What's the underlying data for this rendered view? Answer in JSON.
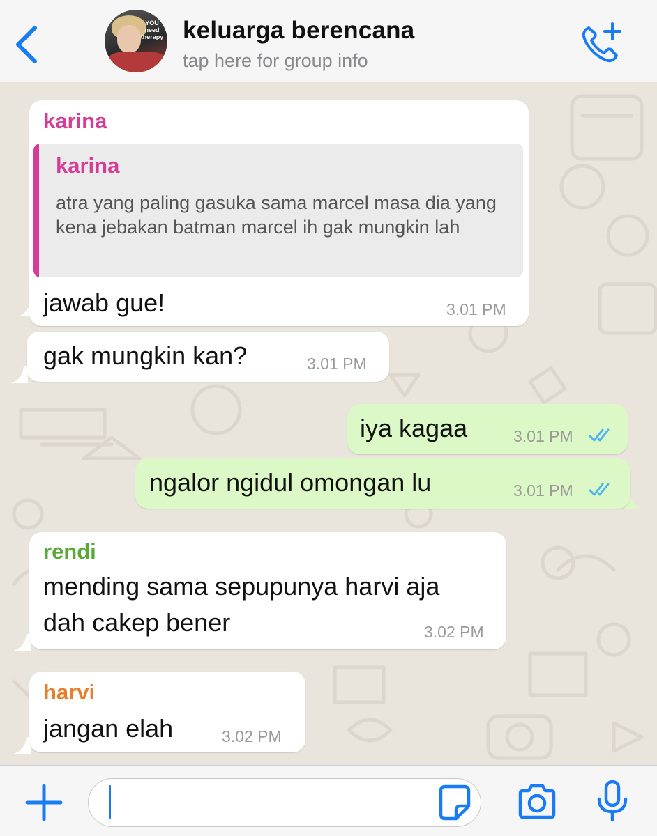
{
  "header": {
    "title": "keluarga berencana",
    "subtitle": "tap here for group info",
    "avatar_caption": "YOU need therapy",
    "accent_color": "#1a7cf5"
  },
  "messages": [
    {
      "direction": "incoming",
      "sender": "karina",
      "sender_color": "#d53c96",
      "reply": {
        "sender": "karina",
        "text": "atra yang paling gasuka sama marcel masa dia yang kena jebakan batman marcel ih gak mungkin lah"
      },
      "text": "jawab gue!",
      "time": "3.01 PM"
    },
    {
      "direction": "incoming",
      "text": "gak mungkin kan?",
      "time": "3.01 PM"
    },
    {
      "direction": "outgoing",
      "text": "iya kagaa",
      "time": "3.01 PM",
      "status": "read"
    },
    {
      "direction": "outgoing",
      "text": "ngalor ngidul omongan lu",
      "time": "3.01 PM",
      "status": "read"
    },
    {
      "direction": "incoming",
      "sender": "rendi",
      "sender_color": "#5aa837",
      "lines": [
        "mending sama sepupunya harvi aja",
        "dah cakep bener"
      ],
      "time": "3.02 PM"
    },
    {
      "direction": "incoming",
      "sender": "harvi",
      "sender_color": "#e57f2e",
      "text": "jangan elah",
      "time": "3.02 PM"
    }
  ],
  "composer": {
    "value": "",
    "icons": [
      "plus-icon",
      "sticker-icon",
      "camera-icon",
      "microphone-icon"
    ]
  },
  "colors": {
    "incoming_bubble": "#ffffff",
    "outgoing_bubble": "#dcf8c6",
    "read_ticks": "#4fb3f0",
    "wallpaper": "#e9e4dc"
  }
}
